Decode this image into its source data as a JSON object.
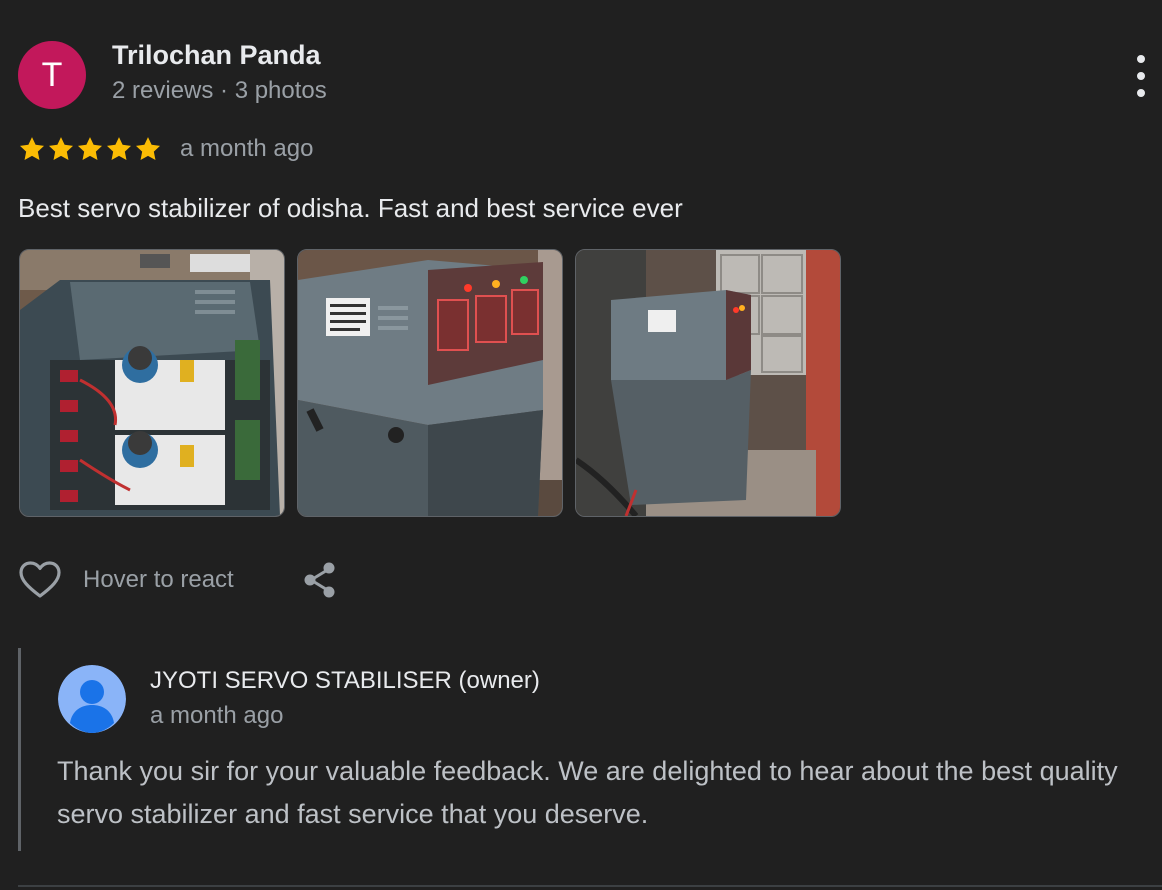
{
  "review": {
    "reviewer": {
      "initial": "T",
      "avatar_color": "#c2185b",
      "name": "Trilochan Panda",
      "meta": "2 reviews · 3 photos"
    },
    "more_icon": "more-vert-icon",
    "rating": {
      "stars": 5,
      "max": 5,
      "star_color": "#fbbc04"
    },
    "date": "a month ago",
    "text": "Best servo stabilizer of odisha. Fast and best service ever",
    "photos": [
      {
        "subject": "stabilizer-interior-photo"
      },
      {
        "subject": "stabilizer-front-photo"
      },
      {
        "subject": "stabilizer-installed-photo"
      }
    ],
    "actions": {
      "react_icon": "heart-icon",
      "react_label": "Hover to react",
      "share_icon": "share-icon"
    }
  },
  "owner_reply": {
    "avatar_icon": "person-avatar-icon",
    "avatar_color": "#8ab4f8",
    "name": "JYOTI SERVO STABILISER (owner)",
    "date": "a month ago",
    "text": "Thank you sir for your valuable feedback. We are delighted to hear about the best quality servo stabilizer and fast service that you deserve."
  }
}
